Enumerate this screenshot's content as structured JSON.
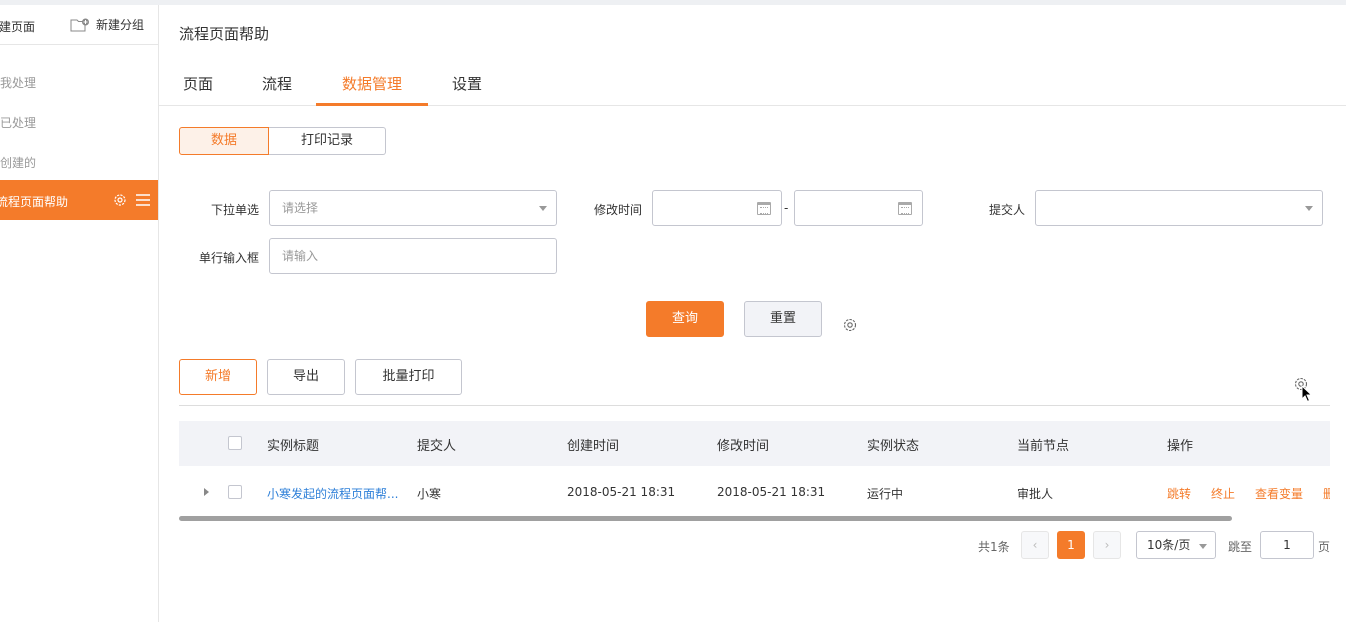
{
  "sidebar": {
    "new_page": "新建页面",
    "new_group": "新建分组",
    "items": [
      {
        "label": "待我处理"
      },
      {
        "label": "我已处理"
      },
      {
        "label": "我创建的"
      }
    ],
    "active_item": "流程页面帮助"
  },
  "main": {
    "title": "流程页面帮助",
    "tabs": [
      "页面",
      "流程",
      "数据管理",
      "设置"
    ],
    "active_tab": "数据管理"
  },
  "segment": {
    "data": "数据",
    "print_log": "打印记录"
  },
  "filters": {
    "dropdown_label": "下拉单选",
    "dropdown_placeholder": "请选择",
    "modified_time_label": "修改时间",
    "range_separator": "-",
    "submitter_label": "提交人",
    "text_label": "单行输入框",
    "text_placeholder": "请输入"
  },
  "actions": {
    "query": "查询",
    "reset": "重置"
  },
  "toolbar": {
    "add": "新增",
    "export": "导出",
    "batch_print": "批量打印"
  },
  "table": {
    "columns": [
      "实例标题",
      "提交人",
      "创建时间",
      "修改时间",
      "实例状态",
      "当前节点",
      "操作"
    ],
    "rows": [
      {
        "title": "小寒发起的流程页面帮...",
        "submitter": "小寒",
        "created": "2018-05-21 18:31",
        "modified": "2018-05-21 18:31",
        "status": "运行中",
        "node": "审批人",
        "ops": [
          "跳转",
          "终止",
          "查看变量",
          "删"
        ]
      }
    ]
  },
  "pagination": {
    "total": "共1条",
    "prev": "‹",
    "current": "1",
    "next": "›",
    "page_size": "10条/页",
    "jump_label": "跳至",
    "jump_value": "1",
    "page_unit": "页"
  },
  "colors": {
    "accent": "#f47b2a",
    "link": "#2d7fd8",
    "header_bg": "#f2f3f7"
  }
}
